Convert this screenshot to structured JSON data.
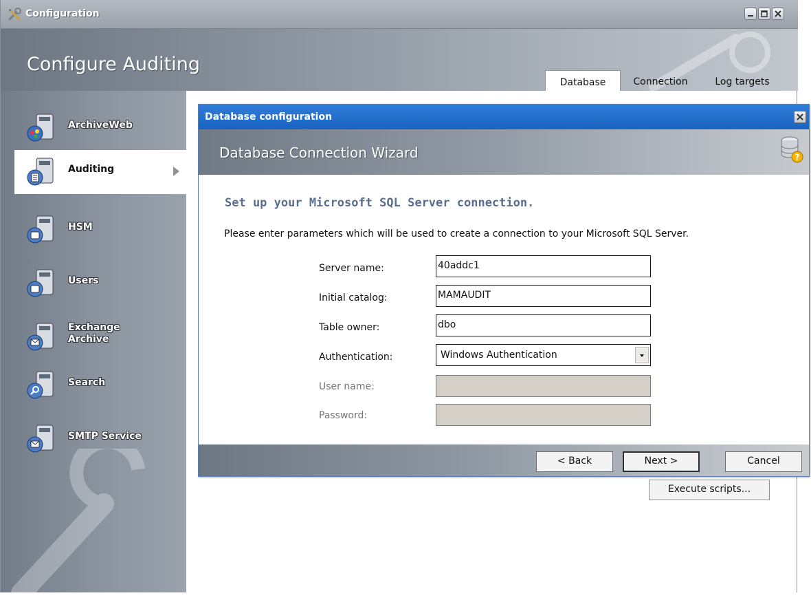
{
  "window": {
    "title": "Configuration",
    "heading": "Configure Auditing"
  },
  "tabs": [
    {
      "label": "Database",
      "active": true
    },
    {
      "label": "Connection",
      "active": false
    },
    {
      "label": "Log targets",
      "active": false
    }
  ],
  "sidebar": {
    "items": [
      {
        "label": "ArchiveWeb",
        "icon": "archiveweb-icon"
      },
      {
        "label": "Auditing",
        "icon": "auditing-icon",
        "active": true
      },
      {
        "label": "HSM",
        "icon": "hsm-icon"
      },
      {
        "label": "Users",
        "icon": "users-icon"
      },
      {
        "label_line1": "Exchange",
        "label_line2": "Archive",
        "icon": "exchange-archive-icon"
      },
      {
        "label": "Search",
        "icon": "search-icon"
      },
      {
        "label": "SMTP Service",
        "icon": "smtp-service-icon"
      }
    ]
  },
  "content": {
    "execute_button": "Execute scripts..."
  },
  "dialog": {
    "title": "Database configuration",
    "wizard_title": "Database Connection Wizard",
    "subheading": "Set up your Microsoft SQL Server connection.",
    "description": "Please enter parameters which will be used to create a connection to your Microsoft SQL Server.",
    "fields": {
      "server_name": {
        "label": "Server name:",
        "value": "40addc1"
      },
      "initial_catalog": {
        "label": "Initial catalog:",
        "value": "MAMAUDIT"
      },
      "table_owner": {
        "label": "Table owner:",
        "value": "dbo"
      },
      "authentication": {
        "label": "Authentication:",
        "value": "Windows Authentication"
      },
      "user_name": {
        "label": "User name:",
        "value": ""
      },
      "password": {
        "label": "Password:",
        "value": ""
      }
    },
    "buttons": {
      "back": "< Back",
      "next": "Next >",
      "cancel": "Cancel"
    }
  },
  "colors": {
    "dialog_titlebar": "#1a63c0",
    "subheading": "#5b7090",
    "disabled_field": "#d4d0c8"
  }
}
